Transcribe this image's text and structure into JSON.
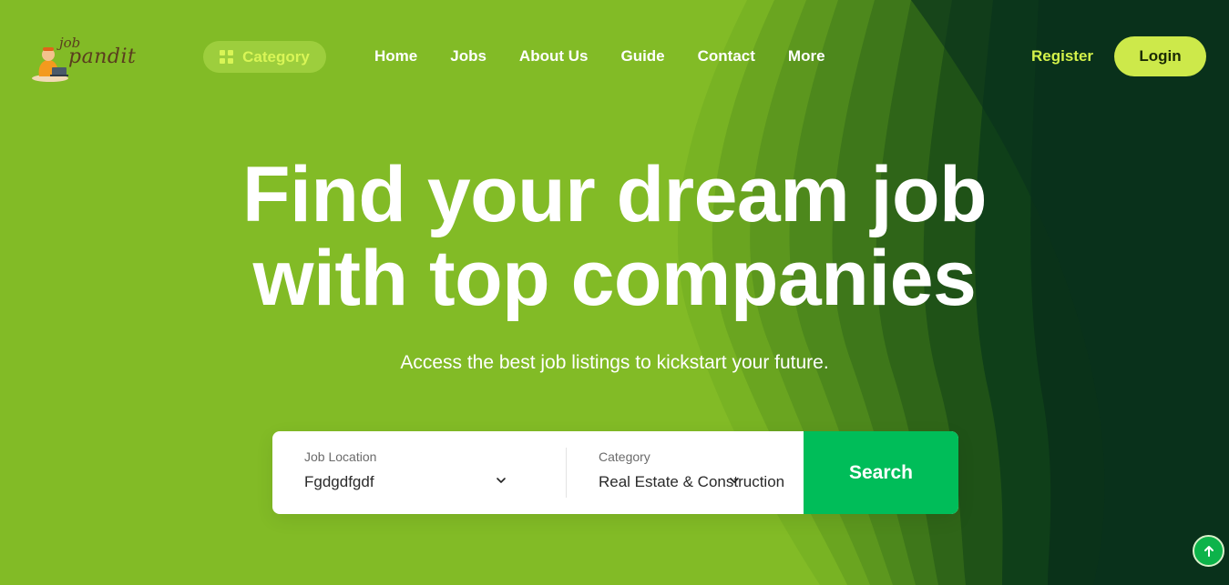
{
  "colors": {
    "background": "#82bb26",
    "accent_lime": "#cde94a",
    "search_green": "#00bd59",
    "dark_green": "#0b3a1c"
  },
  "header": {
    "logo": {
      "word1": "job",
      "word2": "pandit"
    },
    "category_button": {
      "label": "Category",
      "icon": "grid-icon"
    },
    "nav": [
      {
        "label": "Home"
      },
      {
        "label": "Jobs"
      },
      {
        "label": "About Us"
      },
      {
        "label": "Guide"
      },
      {
        "label": "Contact"
      },
      {
        "label": "More"
      }
    ],
    "register_label": "Register",
    "login_label": "Login"
  },
  "hero": {
    "title_line1": "Find your dream job",
    "title_line2": "with top companies",
    "subtitle": "Access the best job listings to kickstart your future."
  },
  "search": {
    "location": {
      "label": "Job Location",
      "value": "Fgdgdfgdf",
      "icon": "chevron-down-icon"
    },
    "category": {
      "label": "Category",
      "value": "Real Estate & Construction",
      "icon": "chevron-down-icon"
    },
    "button_label": "Search"
  },
  "scroll_top": {
    "icon": "arrow-up-icon"
  }
}
